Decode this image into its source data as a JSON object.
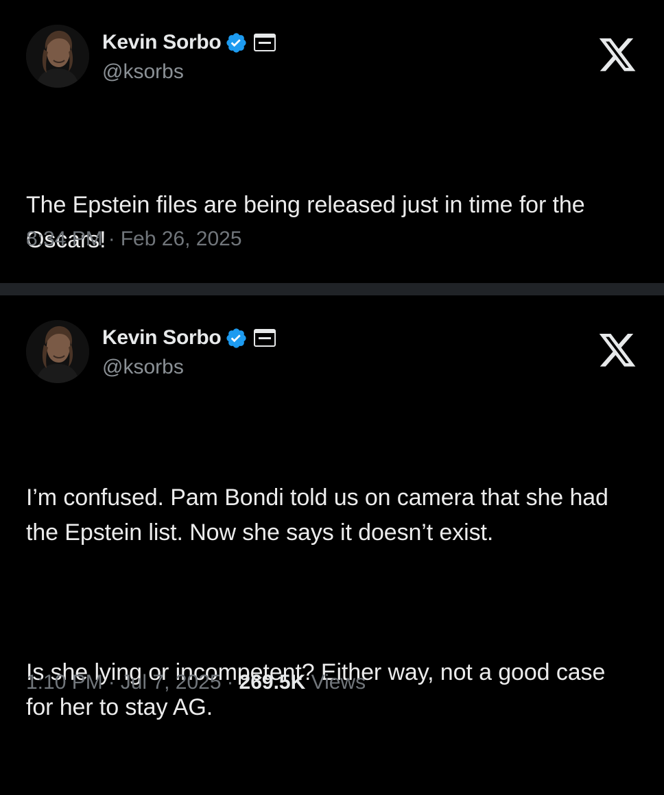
{
  "tweets": [
    {
      "author": {
        "display_name": "Kevin Sorbo",
        "handle": "@ksorbs",
        "verified_icon": "verified-badge-icon",
        "affiliate_icon": "affiliate-badge-icon"
      },
      "platform_icon": "x-logo-icon",
      "text": [
        "The Epstein files are being released just in time for the Oscars!"
      ],
      "time": "8:34 PM",
      "separator": "·",
      "date": "Feb 26, 2025"
    },
    {
      "author": {
        "display_name": "Kevin Sorbo",
        "handle": "@ksorbs",
        "verified_icon": "verified-badge-icon",
        "affiliate_icon": "affiliate-badge-icon"
      },
      "platform_icon": "x-logo-icon",
      "text": [
        "I’m confused. Pam Bondi told us on camera that she had the Epstein list. Now she says it doesn’t exist.",
        "Is she lying or incompetent? Either way, not a good case for her to stay AG."
      ],
      "time": "1:10 PM",
      "separator": "·",
      "date": "Jul 7, 2025",
      "views_count": "269.5K",
      "views_label": "Views"
    }
  ],
  "colors": {
    "background": "#000000",
    "divider": "#202327",
    "text": "#e7e9ea",
    "secondary": "#71767b",
    "verified_blue": "#1d9bf0"
  }
}
